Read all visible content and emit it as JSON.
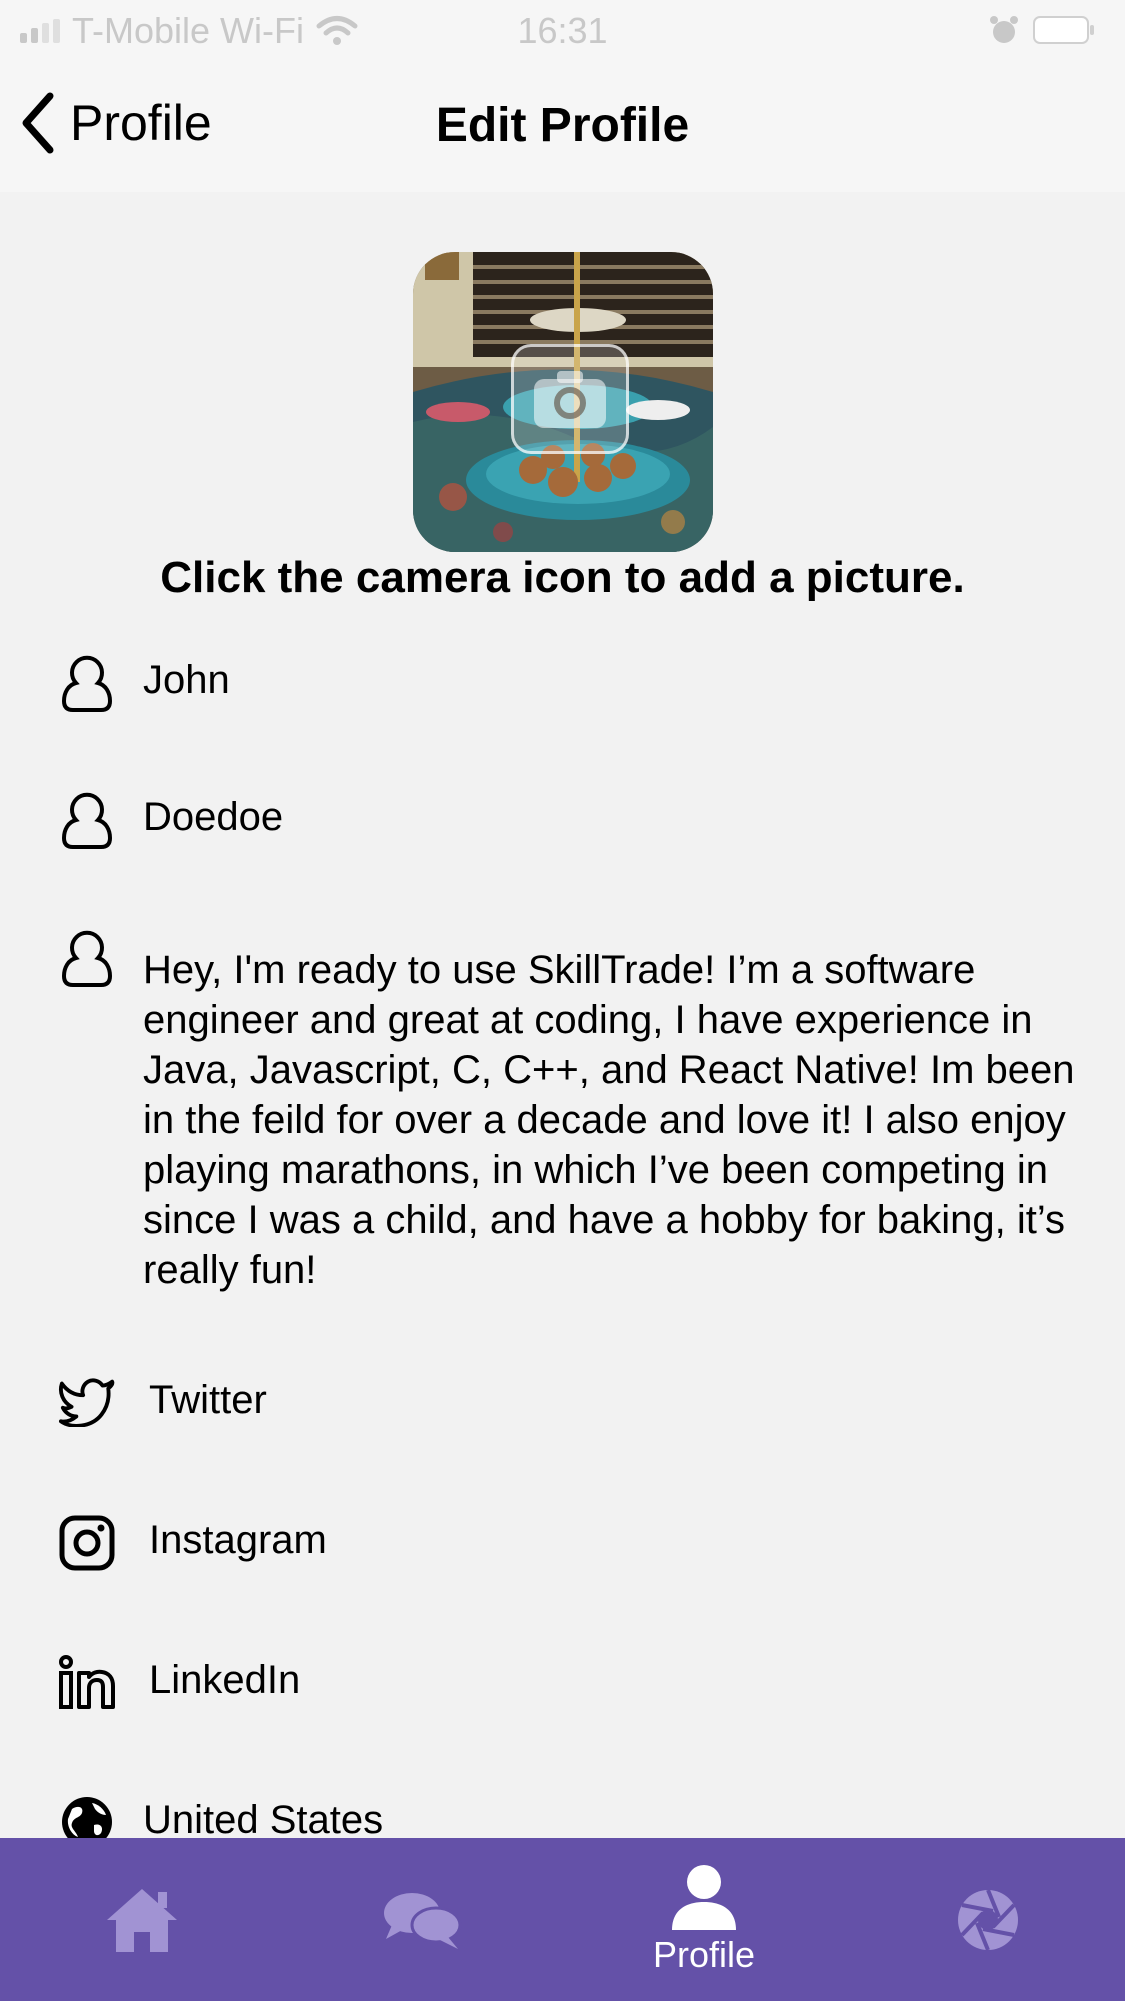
{
  "status_bar": {
    "carrier": "T-Mobile Wi-Fi",
    "time": "16:31",
    "icons": [
      "signal-icon",
      "wifi-icon",
      "alarm-icon",
      "battery-icon"
    ]
  },
  "nav": {
    "back_label": "Profile",
    "title": "Edit Profile"
  },
  "profile_picture": {
    "hint": "Click the camera icon to add a picture.",
    "overlay_icon": "camera-icon"
  },
  "fields": {
    "first_name": "John",
    "last_name": "Doedoe",
    "bio": "Hey, I'm ready to use SkillTrade! I’m a software engineer and great at coding, I have experience in Java, Javascript, C, C++, and React Native! Im been in the feild for over a decade and love it! I also enjoy playing marathons, in which I’ve been competing in since I was a child, and have a hobby for baking, it’s really fun!",
    "twitter": "Twitter",
    "instagram": "Instagram",
    "linkedin": "LinkedIn",
    "country": "United States"
  },
  "tab_bar": {
    "items": [
      {
        "icon": "home-icon",
        "label": ""
      },
      {
        "icon": "chat-icon",
        "label": ""
      },
      {
        "icon": "person-icon",
        "label": "Profile",
        "active": true
      },
      {
        "icon": "aperture-icon",
        "label": ""
      }
    ]
  },
  "colors": {
    "tab_bar": "#6451a8",
    "inactive_icon": "#a193d3",
    "background": "#f2f2f2"
  }
}
